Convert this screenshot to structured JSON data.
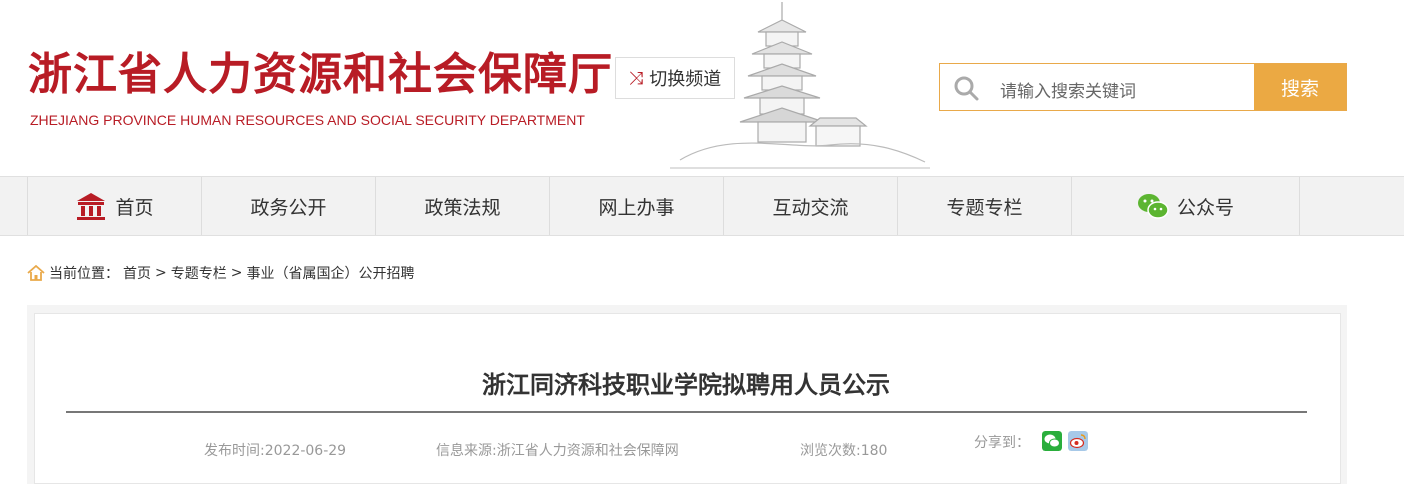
{
  "header": {
    "site_name_cn": "浙江省人力资源和社会保障厅",
    "site_name_en": "ZHEJIANG PROVINCE HUMAN RESOURCES AND SOCIAL SECURITY DEPARTMENT",
    "switch_label": "切换频道",
    "search": {
      "placeholder": "请输入搜索关键词",
      "button_label": "搜索"
    }
  },
  "nav": {
    "items": [
      {
        "label": "首页",
        "icon": "home-icon"
      },
      {
        "label": "政务公开"
      },
      {
        "label": "政策法规"
      },
      {
        "label": "网上办事"
      },
      {
        "label": "互动交流"
      },
      {
        "label": "专题专栏"
      },
      {
        "label": "公众号",
        "icon": "wechat-icon"
      }
    ]
  },
  "breadcrumb": {
    "prefix": "当前位置：",
    "items": [
      "首页",
      "专题专栏",
      "事业（省属国企）公开招聘"
    ],
    "separator": ">"
  },
  "article": {
    "title": "浙江同济科技职业学院拟聘用人员公示",
    "publish_time": "发布时间:2022-06-29",
    "source": "信息来源:浙江省人力资源和社会保障网",
    "views": "浏览次数:180",
    "share_label": "分享到："
  },
  "colors": {
    "brand_red": "#b81c25",
    "search_accent": "#eba943",
    "nav_bg": "#f2f2f2"
  }
}
